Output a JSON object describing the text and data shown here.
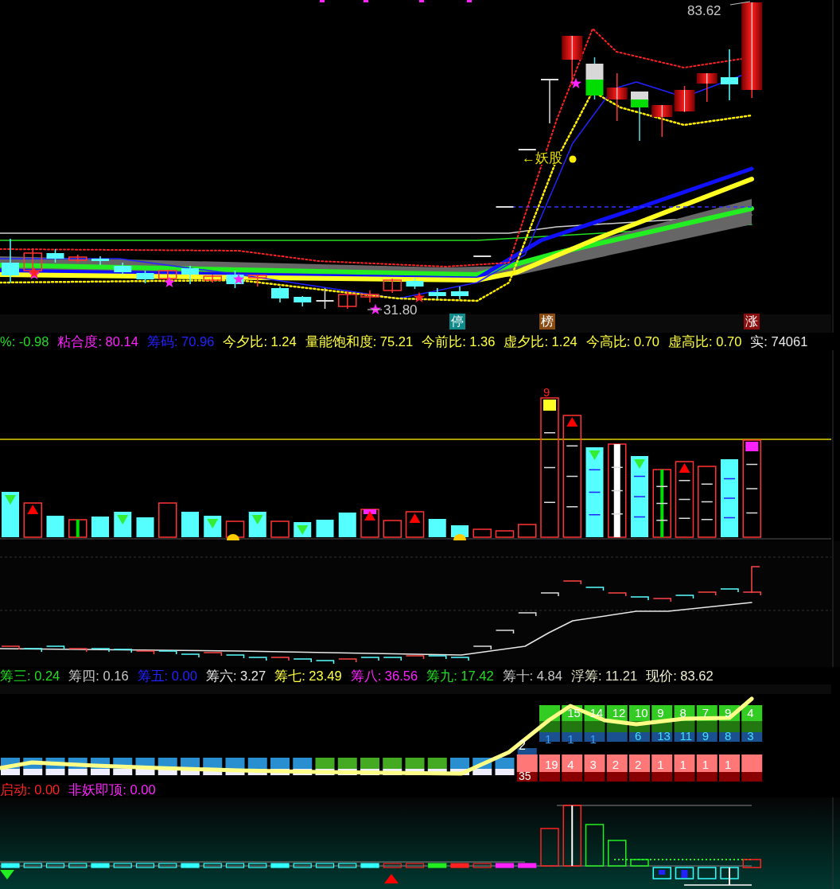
{
  "main_chart": {
    "high_label": "83.62",
    "low_label": "31.80",
    "annotation": "←妖股",
    "badges": [
      {
        "text": "停",
        "color": "#0f8a8a"
      },
      {
        "text": "榜",
        "color": "#8a4b12"
      },
      {
        "text": "涨",
        "color": "#8b0d0d"
      }
    ]
  },
  "indicator_line": [
    {
      "text": "%: -0.98",
      "color": "#22dd22"
    },
    {
      "text": "粘合度: 80.14",
      "color": "#ff22ff"
    },
    {
      "text": "筹码: 70.96",
      "color": "#2222ff"
    },
    {
      "text": "今夕比: 1.24",
      "color": "#ffff44"
    },
    {
      "text": "量能饱和度: 75.21",
      "color": "#ffff44"
    },
    {
      "text": "今前比: 1.36",
      "color": "#ffff44"
    },
    {
      "text": "虚夕比: 1.24",
      "color": "#ffff44"
    },
    {
      "text": "今高比: 0.70",
      "color": "#ffff44"
    },
    {
      "text": "虚高比: 0.70",
      "color": "#ffff44"
    },
    {
      "text": "实: 74061",
      "color": "#e8e8e8"
    }
  ],
  "volume_panel": {
    "peak_label": "9"
  },
  "chip_line": [
    {
      "text": "筹三: 0.24",
      "color": "#22dd22"
    },
    {
      "text": "筹四: 0.16",
      "color": "#c8c8c8"
    },
    {
      "text": "筹五: 0.00",
      "color": "#2222ff"
    },
    {
      "text": "筹六: 3.27",
      "color": "#e8e8e8"
    },
    {
      "text": "筹七: 23.49",
      "color": "#ffff44"
    },
    {
      "text": "筹八: 36.56",
      "color": "#ff22ff"
    },
    {
      "text": "筹九: 17.42",
      "color": "#22dd22"
    },
    {
      "text": "筹十: 4.84",
      "color": "#c8c8c8"
    },
    {
      "text": "浮筹: 11.21",
      "color": "#e0e0c0"
    },
    {
      "text": "现价: 83.62",
      "color": "#f0f0d0"
    }
  ],
  "chip_panel": {
    "left_labels": [
      "2",
      "35"
    ],
    "top_row": [
      "15",
      "14",
      "12",
      "10",
      "9",
      "8",
      "7",
      "9",
      "4"
    ],
    "blue_row": [
      "1",
      "1",
      "1"
    ],
    "cyan_row": [
      "6",
      "13",
      "11",
      "9",
      "8",
      "3"
    ],
    "red_row": [
      "19",
      "4",
      "3",
      "2",
      "2",
      "1",
      "1",
      "1",
      "1"
    ]
  },
  "signal_line": [
    {
      "text": "启动: 0.00",
      "color": "#ff2222"
    },
    {
      "text": "非妖即顶: 0.00",
      "color": "#ff22ff"
    }
  ]
}
